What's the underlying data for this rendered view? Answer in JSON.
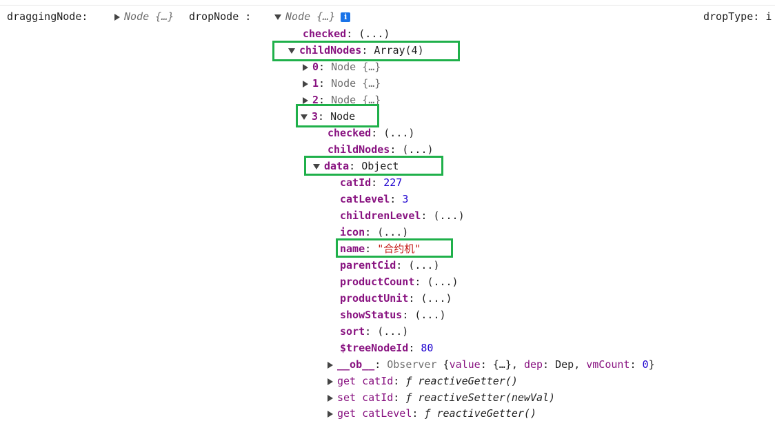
{
  "header": {
    "dragging_key": "draggingNode:",
    "dragging_preview": "Node {…}",
    "drop_key": "dropNode :",
    "drop_preview": "Node {…}",
    "info_badge": "i",
    "droptype_key": "dropType:",
    "droptype_value": "i"
  },
  "tree": {
    "checked": {
      "key": "checked",
      "value": "(...)"
    },
    "childNodes": {
      "key": "childNodes",
      "value": "Array(4)"
    },
    "child0": {
      "key": "0",
      "preview": "Node {…}"
    },
    "child1": {
      "key": "1",
      "preview": "Node {…}"
    },
    "child2": {
      "key": "2",
      "preview": "Node {…}"
    },
    "child3": {
      "key": "3",
      "value": "Node"
    },
    "n3_checked": {
      "key": "checked",
      "value": "(...)"
    },
    "n3_childNodes": {
      "key": "childNodes",
      "value": "(...)"
    },
    "data": {
      "key": "data",
      "value": "Object"
    },
    "fields": [
      {
        "key": "catId",
        "value": "227",
        "kind": "num"
      },
      {
        "key": "catLevel",
        "value": "3",
        "kind": "num"
      },
      {
        "key": "childrenLevel",
        "value": "(...)",
        "kind": "plain"
      },
      {
        "key": "icon",
        "value": "(...)",
        "kind": "plain"
      },
      {
        "key": "name",
        "value": "\"合约机\"",
        "kind": "str"
      },
      {
        "key": "parentCid",
        "value": "(...)",
        "kind": "plain"
      },
      {
        "key": "productCount",
        "value": "(...)",
        "kind": "plain"
      },
      {
        "key": "productUnit",
        "value": "(...)",
        "kind": "plain"
      },
      {
        "key": "showStatus",
        "value": "(...)",
        "kind": "plain"
      },
      {
        "key": "sort",
        "value": "(...)",
        "kind": "plain"
      },
      {
        "key": "$treeNodeId",
        "value": "80",
        "kind": "num"
      }
    ],
    "ob": {
      "key": "__ob__",
      "ctor": "Observer",
      "open": "{",
      "k1": "value",
      "v1": "{…}",
      "k2": "dep",
      "v2": "Dep",
      "k3": "vmCount",
      "v3": "0",
      "close": "}"
    },
    "getCatId": {
      "prefix": "get",
      "key": "catId",
      "f": "ƒ",
      "fn": "reactiveGetter()"
    },
    "setCatId": {
      "prefix": "set",
      "key": "catId",
      "f": "ƒ",
      "fn": "reactiveSetter(newVal)"
    },
    "getCatLevel": {
      "prefix": "get",
      "key": "catLevel",
      "f": "ƒ",
      "fn": "reactiveGetter()"
    }
  },
  "colors": {
    "highlight": "#1fb04a",
    "key": "#881280",
    "number": "#1c00cf",
    "string": "#c41a16",
    "info": "#1a73e8"
  }
}
